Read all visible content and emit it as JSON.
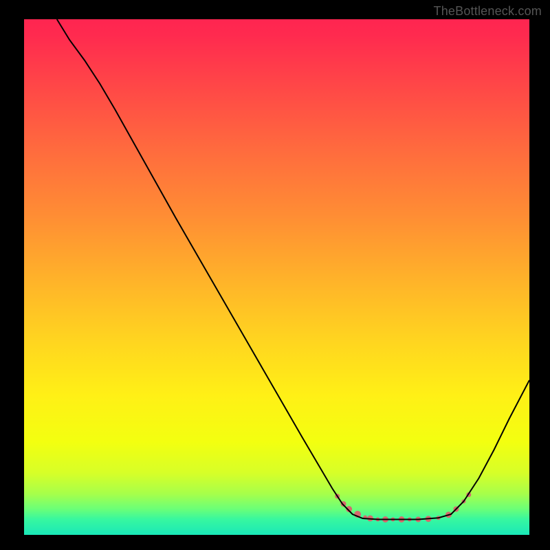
{
  "watermark": "TheBottleneck.com",
  "chart_data": {
    "type": "line",
    "title": "",
    "xlabel": "",
    "ylabel": "",
    "xlim": [
      0,
      100
    ],
    "ylim": [
      0,
      100
    ],
    "gradient_stops": [
      {
        "offset": 0.0,
        "color": "#ff2550"
      },
      {
        "offset": 0.03,
        "color": "#ff2a4f"
      },
      {
        "offset": 0.13,
        "color": "#ff4747"
      },
      {
        "offset": 0.25,
        "color": "#ff6a3e"
      },
      {
        "offset": 0.38,
        "color": "#ff8d34"
      },
      {
        "offset": 0.5,
        "color": "#ffb12a"
      },
      {
        "offset": 0.62,
        "color": "#ffd420"
      },
      {
        "offset": 0.73,
        "color": "#fff016"
      },
      {
        "offset": 0.82,
        "color": "#f3ff10"
      },
      {
        "offset": 0.88,
        "color": "#d7ff28"
      },
      {
        "offset": 0.92,
        "color": "#a7ff4a"
      },
      {
        "offset": 0.95,
        "color": "#6aff78"
      },
      {
        "offset": 0.97,
        "color": "#37f7a0"
      },
      {
        "offset": 1.0,
        "color": "#1ae8b8"
      }
    ],
    "series": [
      {
        "name": "curve",
        "color": "#000000",
        "points": [
          {
            "x": 6.5,
            "y": 100.0
          },
          {
            "x": 9.0,
            "y": 96.0
          },
          {
            "x": 12.0,
            "y": 92.0
          },
          {
            "x": 15.0,
            "y": 87.5
          },
          {
            "x": 18.0,
            "y": 82.5
          },
          {
            "x": 22.0,
            "y": 75.5
          },
          {
            "x": 26.0,
            "y": 68.5
          },
          {
            "x": 30.0,
            "y": 61.5
          },
          {
            "x": 35.0,
            "y": 53.0
          },
          {
            "x": 40.0,
            "y": 44.5
          },
          {
            "x": 45.0,
            "y": 36.0
          },
          {
            "x": 50.0,
            "y": 27.5
          },
          {
            "x": 55.0,
            "y": 19.0
          },
          {
            "x": 58.0,
            "y": 14.0
          },
          {
            "x": 61.0,
            "y": 9.0
          },
          {
            "x": 63.0,
            "y": 6.0
          },
          {
            "x": 65.0,
            "y": 4.0
          },
          {
            "x": 67.0,
            "y": 3.2
          },
          {
            "x": 70.0,
            "y": 3.0
          },
          {
            "x": 74.0,
            "y": 3.0
          },
          {
            "x": 78.0,
            "y": 3.0
          },
          {
            "x": 82.0,
            "y": 3.3
          },
          {
            "x": 84.5,
            "y": 4.0
          },
          {
            "x": 87.0,
            "y": 6.5
          },
          {
            "x": 90.0,
            "y": 11.0
          },
          {
            "x": 93.0,
            "y": 16.5
          },
          {
            "x": 96.0,
            "y": 22.5
          },
          {
            "x": 100.0,
            "y": 30.0
          }
        ]
      }
    ],
    "markers": {
      "color": "#d66a6d",
      "points": [
        {
          "x": 62.0,
          "y": 7.5,
          "r": 3.5
        },
        {
          "x": 63.2,
          "y": 6.0,
          "r": 4.0
        },
        {
          "x": 64.3,
          "y": 5.0,
          "r": 4.5
        },
        {
          "x": 66.0,
          "y": 4.0,
          "r": 5.0
        },
        {
          "x": 67.5,
          "y": 3.4,
          "r": 3.0
        },
        {
          "x": 68.5,
          "y": 3.2,
          "r": 4.5
        },
        {
          "x": 70.0,
          "y": 3.0,
          "r": 3.0
        },
        {
          "x": 71.5,
          "y": 3.0,
          "r": 4.5
        },
        {
          "x": 73.0,
          "y": 3.0,
          "r": 3.0
        },
        {
          "x": 74.7,
          "y": 3.0,
          "r": 4.5
        },
        {
          "x": 76.3,
          "y": 3.0,
          "r": 3.0
        },
        {
          "x": 78.0,
          "y": 3.0,
          "r": 4.0
        },
        {
          "x": 80.0,
          "y": 3.1,
          "r": 4.5
        },
        {
          "x": 82.0,
          "y": 3.3,
          "r": 3.0
        },
        {
          "x": 84.0,
          "y": 3.9,
          "r": 4.5
        },
        {
          "x": 85.5,
          "y": 5.0,
          "r": 4.0
        },
        {
          "x": 87.0,
          "y": 6.5,
          "r": 3.0
        },
        {
          "x": 88.0,
          "y": 7.8,
          "r": 3.5
        }
      ]
    }
  }
}
